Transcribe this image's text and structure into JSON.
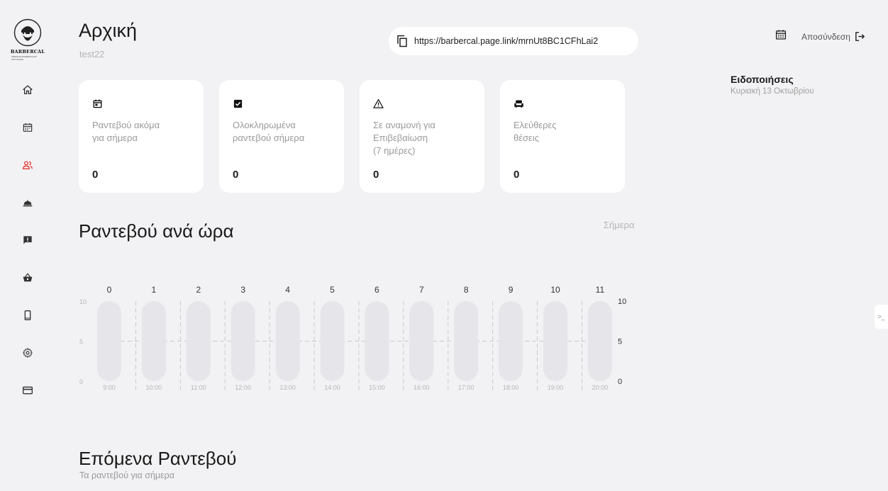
{
  "sidebar": {
    "logo_text": "BARBERCAL",
    "logo_sub": "PREMIUM BARBERSHOP SOFTWARE",
    "items": [
      {
        "name": "home",
        "active": false
      },
      {
        "name": "calendar",
        "active": false
      },
      {
        "name": "users",
        "active": true
      },
      {
        "name": "services",
        "active": false
      },
      {
        "name": "feedback",
        "active": false
      },
      {
        "name": "shop",
        "active": false
      },
      {
        "name": "mobile",
        "active": false
      },
      {
        "name": "settings",
        "active": false
      },
      {
        "name": "payments",
        "active": false
      }
    ],
    "active_color": "#e53935",
    "icon_color": "#333333"
  },
  "header": {
    "title": "Αρχική",
    "subtitle": "test22",
    "link": "https://barbercal.page.link/mrnUt8BC1CFhLai2",
    "logout_label": "Αποσύνδεση"
  },
  "notifications": {
    "title": "Ειδοποιήσεις",
    "date": "Κυριακή 13 Οκτωβρίου"
  },
  "cards": [
    {
      "icon": "calendar-today-icon",
      "label": "Ραντεβού ακόμα\nγια σήμερα",
      "value": "0"
    },
    {
      "icon": "checkbox-icon",
      "label": "Ολοκληρωμένα\nραντεβού σήμερα",
      "value": "0"
    },
    {
      "icon": "warning-icon",
      "label": "Σε αναμονή για\nΕπιβεβαίωση\n(7 ημέρες)",
      "value": "0"
    },
    {
      "icon": "chair-icon",
      "label": "Ελεύθερες\n θέσεις",
      "value": "0"
    }
  ],
  "chart_section": {
    "title": "Ραντεβού ανά ώρα",
    "period": "Σήμερα"
  },
  "chart_data": {
    "type": "bar",
    "categories": [
      "9:00",
      "10:00",
      "11:00",
      "12:00",
      "13:00",
      "14:00",
      "15:00",
      "16:00",
      "17:00",
      "18:00",
      "19:00",
      "20:00"
    ],
    "top_labels": [
      "0",
      "1",
      "2",
      "3",
      "4",
      "5",
      "6",
      "7",
      "8",
      "9",
      "10",
      "11"
    ],
    "values": [
      0,
      0,
      0,
      0,
      0,
      0,
      0,
      0,
      0,
      0,
      0,
      0
    ],
    "ylim": [
      0,
      10
    ],
    "yticks": [
      0,
      5,
      10
    ],
    "grid": true,
    "bar_track_color": "#e6e6ea",
    "bar_color": "#e53935"
  },
  "next_section": {
    "title": "Επόμενα Ραντεβού",
    "subtitle": "Τα ραντεβού για σήμερα"
  },
  "edge_tab": {
    "label": ">_"
  }
}
